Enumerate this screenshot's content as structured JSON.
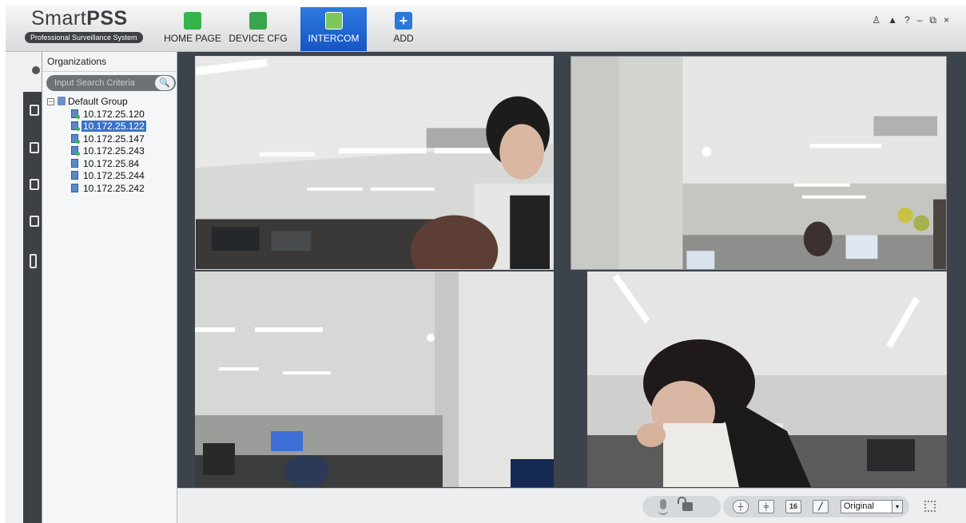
{
  "app": {
    "brand_light": "Smart",
    "brand_bold": "PSS",
    "tagline": "Professional Surveillance System"
  },
  "nav": [
    {
      "label": "HOME PAGE",
      "icon": "home-icon"
    },
    {
      "label": "DEVICE CFG",
      "icon": "device-config-icon"
    },
    {
      "label": "INTERCOM",
      "icon": "intercom-icon",
      "active": true
    },
    {
      "label": "ADD",
      "icon": "add-icon"
    }
  ],
  "window_controls": [
    "user-icon",
    "lock-icon",
    "help-icon",
    "minimize-icon",
    "restore-icon",
    "close-icon"
  ],
  "window_control_glyphs": {
    "user": "♙",
    "lock": "▲",
    "help": "?",
    "minimize": "–",
    "restore": "⧉",
    "close": "×"
  },
  "sidebar_icons": [
    "person-icon",
    "card-icon",
    "broadcast-icon",
    "mail-icon",
    "note-icon",
    "phone-icon"
  ],
  "org": {
    "title": "Organizations",
    "search_placeholder": "Input Search Criteria",
    "group": {
      "toggle": "−",
      "name": "Default Group",
      "devices": [
        {
          "ip": "10.172.25.120",
          "online": true
        },
        {
          "ip": "10.172.25.122",
          "online": true,
          "selected": true
        },
        {
          "ip": "10.172.25.147",
          "online": true
        },
        {
          "ip": "10.172.25.243",
          "online": true
        },
        {
          "ip": "10.172.25.84",
          "online": false
        },
        {
          "ip": "10.172.25.244",
          "online": false
        },
        {
          "ip": "10.172.25.242",
          "online": false
        }
      ]
    }
  },
  "toolbar": {
    "layout_16_label": "16",
    "scale_value": "Original",
    "dropdown_glyph": "▾",
    "search_glyph": "🔍"
  },
  "colors": {
    "accent": "#1a5fc8",
    "video_bg": "#3c434a",
    "selected": "#3a73c8"
  }
}
